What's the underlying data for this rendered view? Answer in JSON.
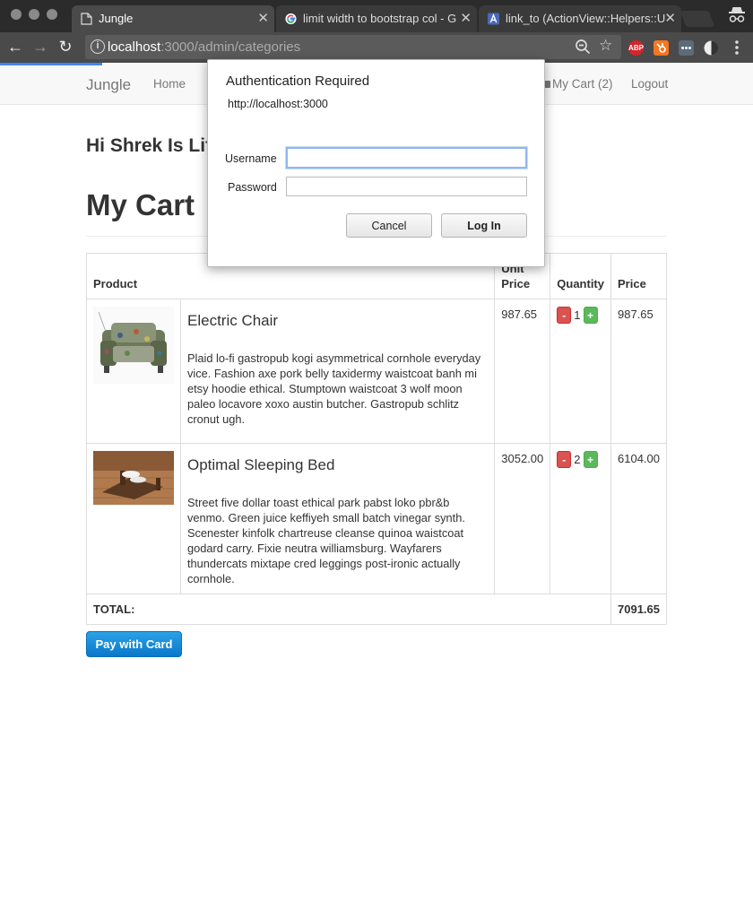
{
  "browser": {
    "tabs": [
      {
        "title": "Jungle",
        "active": true
      },
      {
        "title": "limit width to bootstrap col - G",
        "active": false
      },
      {
        "title": "link_to (ActionView::Helpers::U",
        "active": false
      }
    ],
    "url_host": "localhost",
    "url_path": ":3000/admin/categories",
    "extensions": [
      "ABP"
    ]
  },
  "navbar": {
    "brand": "Jungle",
    "home": "Home",
    "cart": "My Cart (2)",
    "logout": "Logout"
  },
  "page": {
    "greeting": "Hi Shrek Is Lif",
    "title": "My Cart",
    "pay_button": "Pay with Card"
  },
  "table": {
    "headers": {
      "product": "Product",
      "unit_price": "Unit Price",
      "quantity": "Quantity",
      "price": "Price"
    },
    "items": [
      {
        "name": "Electric Chair",
        "description": "Plaid lo-fi gastropub kogi asymmetrical cornhole everyday vice. Fashion axe pork belly taxidermy waistcoat banh mi etsy hoodie ethical. Stumptown waistcoat 3 wolf moon paleo locavore xoxo austin butcher. Gastropub schlitz cronut ugh.",
        "unit_price": "987.65",
        "quantity": "1",
        "price": "987.65"
      },
      {
        "name": "Optimal Sleeping Bed",
        "description": "Street five dollar toast ethical park pabst loko pbr&b venmo. Green juice keffiyeh small batch vinegar synth. Scenester kinfolk chartreuse cleanse quinoa waistcoat godard carry. Fixie neutra williamsburg. Wayfarers thundercats mixtape cred leggings post-ironic actually cornhole.",
        "unit_price": "3052.00",
        "quantity": "2",
        "price": "6104.00"
      }
    ],
    "minus_label": "-",
    "plus_label": "+",
    "total_label": "TOTAL:",
    "total_value": "7091.65"
  },
  "auth": {
    "title": "Authentication Required",
    "origin": "http://localhost:3000",
    "username_label": "Username",
    "password_label": "Password",
    "username_value": "",
    "password_value": "",
    "cancel": "Cancel",
    "login": "Log In"
  },
  "colors": {
    "accent_blue": "#4285f4",
    "minus_red": "#d9534f",
    "plus_green": "#5cb85c",
    "pay_blue": "#1a8fd8"
  }
}
